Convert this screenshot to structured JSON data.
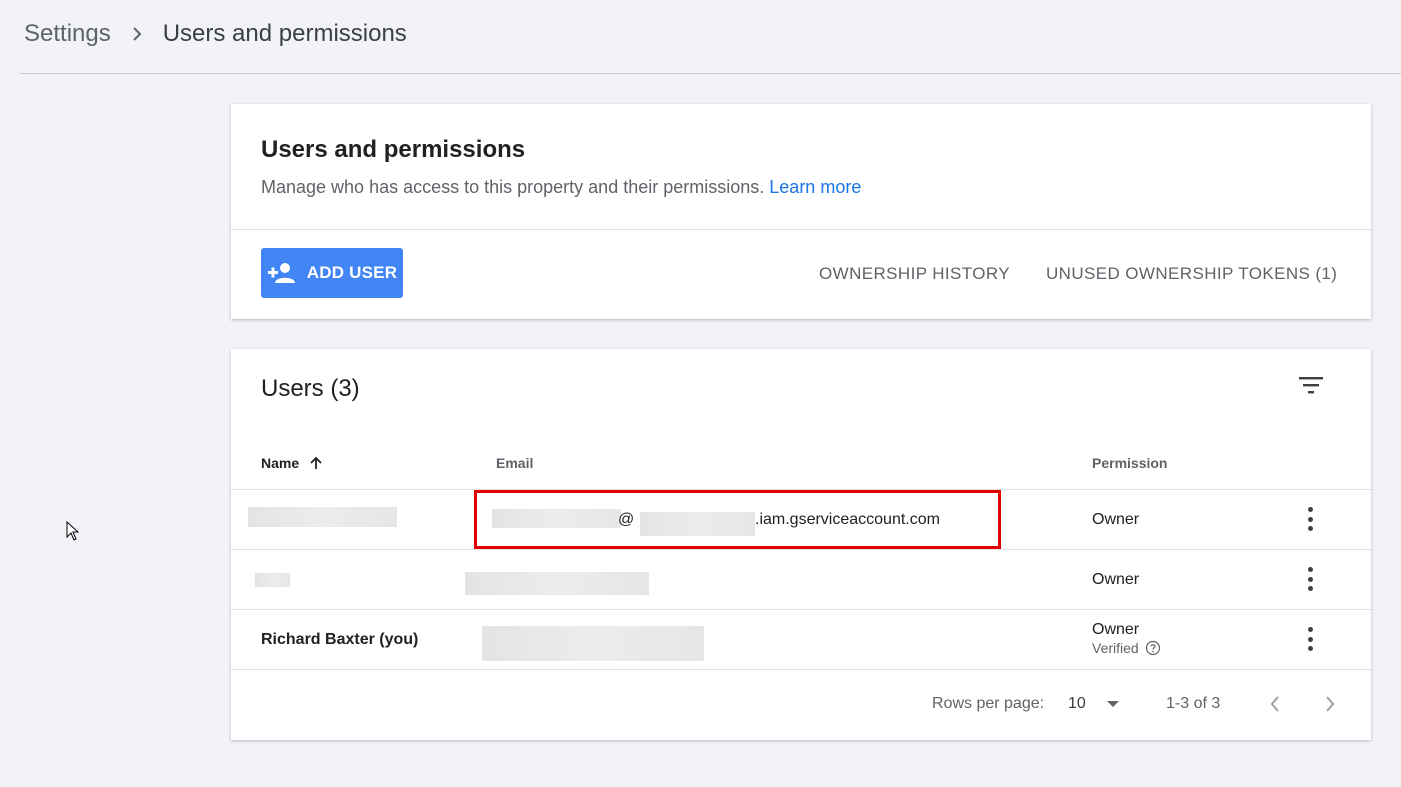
{
  "breadcrumb": {
    "parent": "Settings",
    "current": "Users and permissions"
  },
  "header_card": {
    "title": "Users and permissions",
    "description": "Manage who has access to this property and their permissions.",
    "learn_more": "Learn more",
    "add_user": "ADD USER",
    "ownership_history": "OWNERSHIP HISTORY",
    "unused_tokens": "UNUSED OWNERSHIP TOKENS (1)"
  },
  "users_card": {
    "title": "Users (3)",
    "columns": {
      "name": "Name",
      "email": "Email",
      "permission": "Permission"
    },
    "rows": [
      {
        "name": "",
        "email_visible_1": "@",
        "email_visible_2": ".iam.gserviceaccount.com",
        "permission": "Owner",
        "status": ""
      },
      {
        "name": "",
        "email": "",
        "permission": "Owner",
        "status": ""
      },
      {
        "name": "Richard Baxter (you)",
        "email": "",
        "permission": "Owner",
        "status": "Verified"
      }
    ],
    "pagination": {
      "rows_per_page_label": "Rows per page:",
      "rows_per_page": "10",
      "range": "1-3 of 3"
    }
  },
  "colors": {
    "primary": "#4285f4",
    "link": "#1a73e8",
    "highlight": "#e00000"
  },
  "icons": [
    "chevron-right-icon",
    "person-add-icon",
    "filter-icon",
    "arrow-up-icon",
    "more-vert-icon",
    "help-circle-icon",
    "dropdown-arrow-icon",
    "chevron-left-icon",
    "cursor-icon"
  ]
}
